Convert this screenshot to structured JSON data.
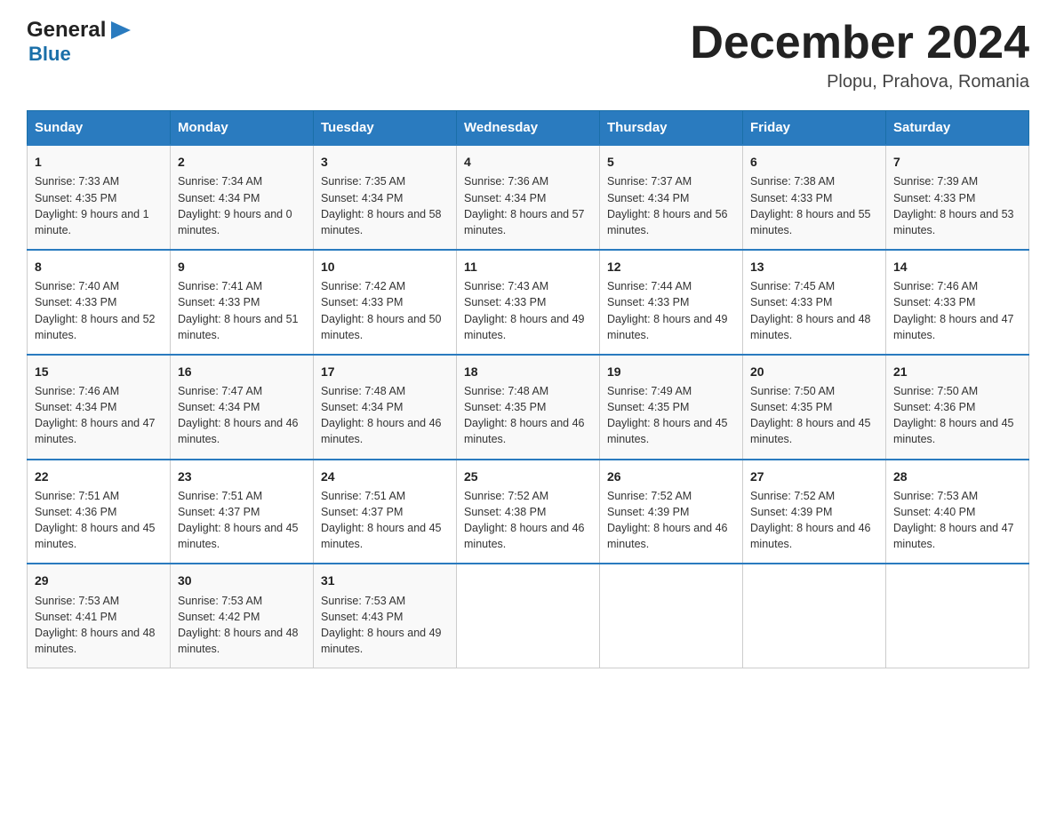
{
  "logo": {
    "general": "General",
    "arrow": "▶",
    "blue": "Blue"
  },
  "header": {
    "month": "December 2024",
    "location": "Plopu, Prahova, Romania"
  },
  "weekdays": [
    "Sunday",
    "Monday",
    "Tuesday",
    "Wednesday",
    "Thursday",
    "Friday",
    "Saturday"
  ],
  "weeks": [
    [
      {
        "day": "1",
        "sunrise": "7:33 AM",
        "sunset": "4:35 PM",
        "daylight": "9 hours and 1 minute."
      },
      {
        "day": "2",
        "sunrise": "7:34 AM",
        "sunset": "4:34 PM",
        "daylight": "9 hours and 0 minutes."
      },
      {
        "day": "3",
        "sunrise": "7:35 AM",
        "sunset": "4:34 PM",
        "daylight": "8 hours and 58 minutes."
      },
      {
        "day": "4",
        "sunrise": "7:36 AM",
        "sunset": "4:34 PM",
        "daylight": "8 hours and 57 minutes."
      },
      {
        "day": "5",
        "sunrise": "7:37 AM",
        "sunset": "4:34 PM",
        "daylight": "8 hours and 56 minutes."
      },
      {
        "day": "6",
        "sunrise": "7:38 AM",
        "sunset": "4:33 PM",
        "daylight": "8 hours and 55 minutes."
      },
      {
        "day": "7",
        "sunrise": "7:39 AM",
        "sunset": "4:33 PM",
        "daylight": "8 hours and 53 minutes."
      }
    ],
    [
      {
        "day": "8",
        "sunrise": "7:40 AM",
        "sunset": "4:33 PM",
        "daylight": "8 hours and 52 minutes."
      },
      {
        "day": "9",
        "sunrise": "7:41 AM",
        "sunset": "4:33 PM",
        "daylight": "8 hours and 51 minutes."
      },
      {
        "day": "10",
        "sunrise": "7:42 AM",
        "sunset": "4:33 PM",
        "daylight": "8 hours and 50 minutes."
      },
      {
        "day": "11",
        "sunrise": "7:43 AM",
        "sunset": "4:33 PM",
        "daylight": "8 hours and 49 minutes."
      },
      {
        "day": "12",
        "sunrise": "7:44 AM",
        "sunset": "4:33 PM",
        "daylight": "8 hours and 49 minutes."
      },
      {
        "day": "13",
        "sunrise": "7:45 AM",
        "sunset": "4:33 PM",
        "daylight": "8 hours and 48 minutes."
      },
      {
        "day": "14",
        "sunrise": "7:46 AM",
        "sunset": "4:33 PM",
        "daylight": "8 hours and 47 minutes."
      }
    ],
    [
      {
        "day": "15",
        "sunrise": "7:46 AM",
        "sunset": "4:34 PM",
        "daylight": "8 hours and 47 minutes."
      },
      {
        "day": "16",
        "sunrise": "7:47 AM",
        "sunset": "4:34 PM",
        "daylight": "8 hours and 46 minutes."
      },
      {
        "day": "17",
        "sunrise": "7:48 AM",
        "sunset": "4:34 PM",
        "daylight": "8 hours and 46 minutes."
      },
      {
        "day": "18",
        "sunrise": "7:48 AM",
        "sunset": "4:35 PM",
        "daylight": "8 hours and 46 minutes."
      },
      {
        "day": "19",
        "sunrise": "7:49 AM",
        "sunset": "4:35 PM",
        "daylight": "8 hours and 45 minutes."
      },
      {
        "day": "20",
        "sunrise": "7:50 AM",
        "sunset": "4:35 PM",
        "daylight": "8 hours and 45 minutes."
      },
      {
        "day": "21",
        "sunrise": "7:50 AM",
        "sunset": "4:36 PM",
        "daylight": "8 hours and 45 minutes."
      }
    ],
    [
      {
        "day": "22",
        "sunrise": "7:51 AM",
        "sunset": "4:36 PM",
        "daylight": "8 hours and 45 minutes."
      },
      {
        "day": "23",
        "sunrise": "7:51 AM",
        "sunset": "4:37 PM",
        "daylight": "8 hours and 45 minutes."
      },
      {
        "day": "24",
        "sunrise": "7:51 AM",
        "sunset": "4:37 PM",
        "daylight": "8 hours and 45 minutes."
      },
      {
        "day": "25",
        "sunrise": "7:52 AM",
        "sunset": "4:38 PM",
        "daylight": "8 hours and 46 minutes."
      },
      {
        "day": "26",
        "sunrise": "7:52 AM",
        "sunset": "4:39 PM",
        "daylight": "8 hours and 46 minutes."
      },
      {
        "day": "27",
        "sunrise": "7:52 AM",
        "sunset": "4:39 PM",
        "daylight": "8 hours and 46 minutes."
      },
      {
        "day": "28",
        "sunrise": "7:53 AM",
        "sunset": "4:40 PM",
        "daylight": "8 hours and 47 minutes."
      }
    ],
    [
      {
        "day": "29",
        "sunrise": "7:53 AM",
        "sunset": "4:41 PM",
        "daylight": "8 hours and 48 minutes."
      },
      {
        "day": "30",
        "sunrise": "7:53 AM",
        "sunset": "4:42 PM",
        "daylight": "8 hours and 48 minutes."
      },
      {
        "day": "31",
        "sunrise": "7:53 AM",
        "sunset": "4:43 PM",
        "daylight": "8 hours and 49 minutes."
      },
      null,
      null,
      null,
      null
    ]
  ],
  "labels": {
    "sunrise": "Sunrise:",
    "sunset": "Sunset:",
    "daylight": "Daylight:"
  }
}
